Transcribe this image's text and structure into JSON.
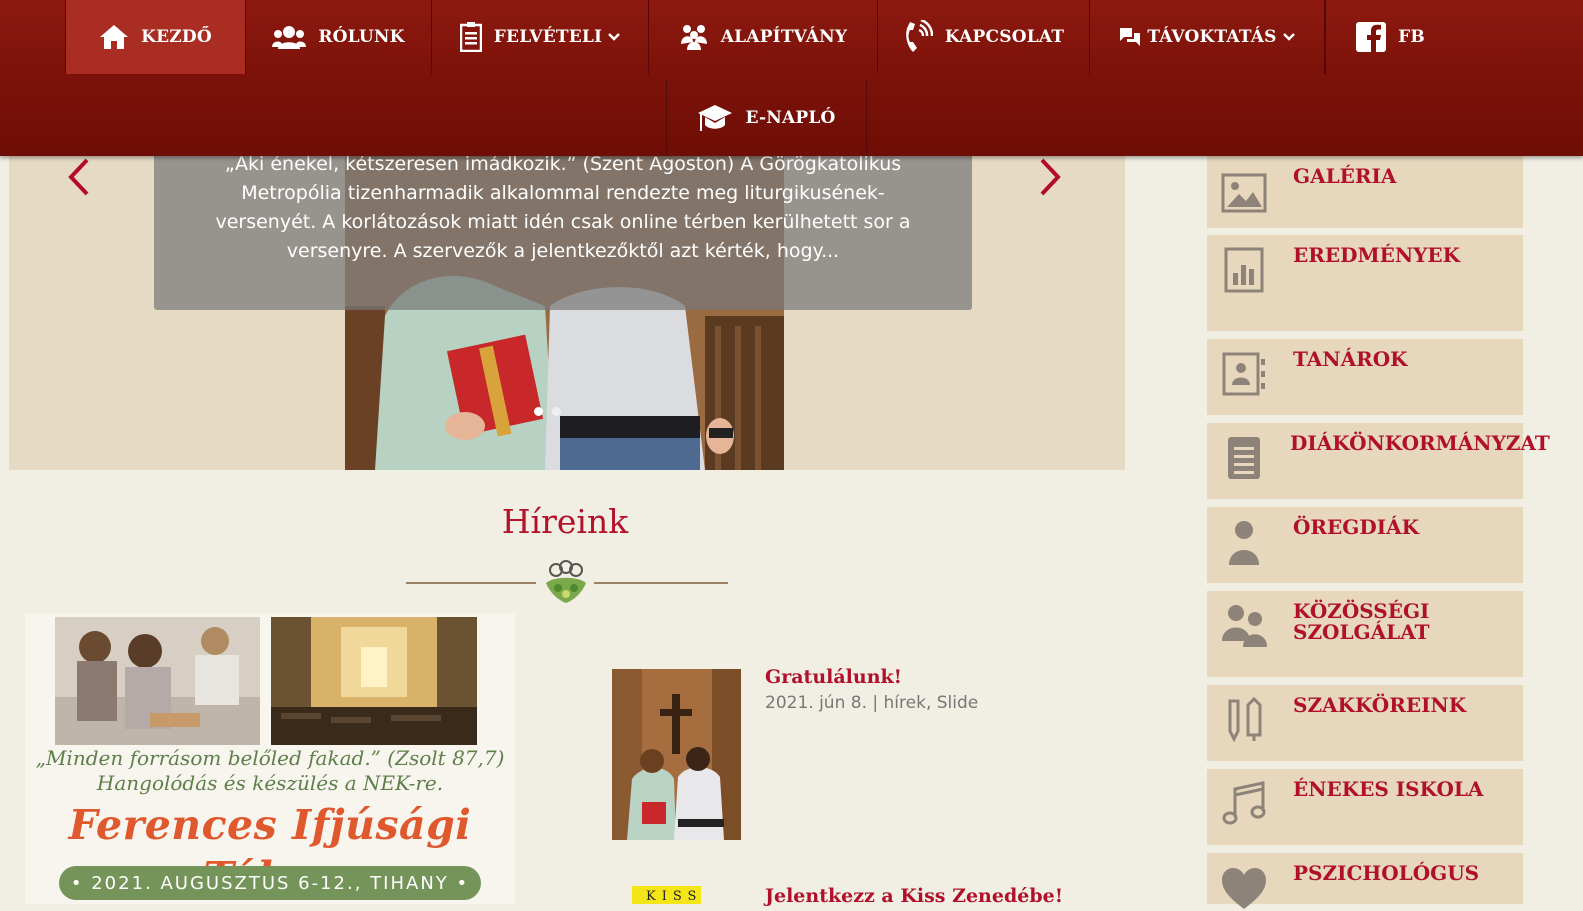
{
  "nav": {
    "items": [
      {
        "label": "KEZDŐ",
        "icon": "home-icon"
      },
      {
        "label": "RÓLUNK",
        "icon": "group-icon"
      },
      {
        "label": "FELVÉTELI",
        "icon": "document-icon"
      },
      {
        "label": "ALAPÍTVÁNY",
        "icon": "people-icon"
      },
      {
        "label": "KAPCSOLAT",
        "icon": "phone-icon"
      },
      {
        "label": "TÁVOKTATÁS",
        "icon": "chat-icon"
      },
      {
        "label": "FB",
        "icon": "facebook-icon"
      },
      {
        "label": "E-NAPLÓ",
        "icon": "graduation-cap-icon"
      }
    ]
  },
  "slider": {
    "caption": "„Aki énekel, kétszeresen imádkozik.” (Szent Ágoston) A Görögkatolikus Metropólia tizenharmadik alkalommal rendezte meg liturgikusének-versenyét. A korlátozások miatt idén csak online térben kerülhetett sor a versenyre. A szervezők a jelentkezőktől azt kérték, hogy..."
  },
  "news": {
    "title": "Híreink",
    "poster": {
      "quote": "„Minden forrásom belőled fakad.” (Zsolt 87,7) Hangolódás és készülés a NEK-re.",
      "title": "Ferences Ifjúsági Tábor",
      "band": "• 2021. AUGUSZTUS 6-12., TIHANY •"
    },
    "posts": [
      {
        "title": "Gratulálunk!",
        "date": "2021. jún 8.",
        "separator": " | ",
        "category1": "hírek",
        "comma": ", ",
        "category2": "Slide"
      },
      {
        "title": "Jelentkezz a Kiss Zenedébe!",
        "thumb_text": "KISS"
      }
    ]
  },
  "sidebar": {
    "items": [
      {
        "label": "GALÉRIA",
        "icon": "image-icon"
      },
      {
        "label": "EREDMÉNYEK",
        "icon": "bar-chart-icon"
      },
      {
        "label": "TANÁROK",
        "icon": "contact-book-icon"
      },
      {
        "label": "DIÁKÖNKORMÁNYZAT",
        "icon": "document-icon"
      },
      {
        "label": "ÖREGDIÁK",
        "icon": "person-icon"
      },
      {
        "label": "KÖZÖSSÉGI",
        "label2": "SZOLGÁLAT",
        "icon": "users-icon"
      },
      {
        "label": "SZAKKÖREINK",
        "icon": "pencil-icon"
      },
      {
        "label": "ÉNEKES ISKOLA",
        "icon": "music-icon"
      },
      {
        "label": "PSZICHOLÓGUS",
        "icon": "heart-icon"
      }
    ]
  },
  "colors": {
    "nav": "#7d1209",
    "accent": "#b0102a",
    "sidebar_bg": "#e6d7bd",
    "page_bg": "#f1efe3"
  }
}
